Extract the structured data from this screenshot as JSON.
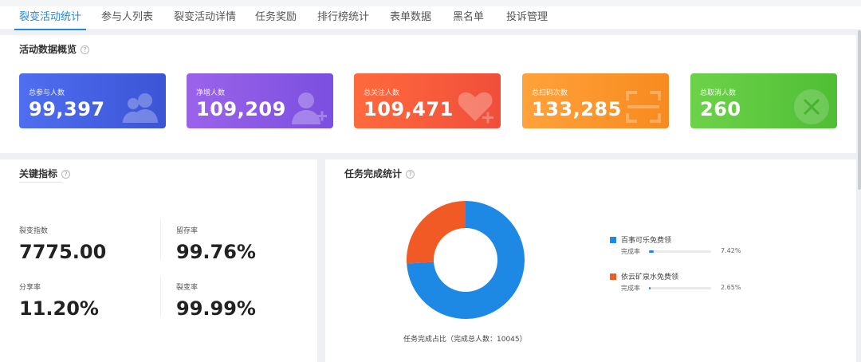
{
  "tabs": [
    {
      "label": "裂变活动统计",
      "active": true
    },
    {
      "label": "参与人列表",
      "active": false
    },
    {
      "label": "裂变活动详情",
      "active": false
    },
    {
      "label": "任务奖励",
      "active": false
    },
    {
      "label": "排行榜统计",
      "active": false
    },
    {
      "label": "表单数据",
      "active": false
    },
    {
      "label": "黑名单",
      "active": false
    },
    {
      "label": "投诉管理",
      "active": false
    }
  ],
  "overview": {
    "title": "活动数据概览",
    "cards": [
      {
        "label": "总参与人数",
        "value": "99,397",
        "color_from": "#4f6ef0",
        "color_to": "#3c54d6",
        "icon": "users-icon"
      },
      {
        "label": "净增人数",
        "value": "109,209",
        "color_from": "#9b63ea",
        "color_to": "#7b4fe0",
        "icon": "user-add-icon"
      },
      {
        "label": "总关注人数",
        "value": "109,471",
        "color_from": "#ff6a3d",
        "color_to": "#f04e3a",
        "icon": "heart-plus-icon"
      },
      {
        "label": "总扫码次数",
        "value": "133,285",
        "color_from": "#ffa23a",
        "color_to": "#f78a1f",
        "icon": "scan-icon"
      },
      {
        "label": "总取消人数",
        "value": "260",
        "color_from": "#6dd24a",
        "color_to": "#4fbe35",
        "icon": "close-circle-icon"
      }
    ]
  },
  "key_metrics": {
    "title": "关键指标",
    "items": [
      {
        "label": "裂变指数",
        "value": "7775.00"
      },
      {
        "label": "留存率",
        "value": "99.76%"
      },
      {
        "label": "分享率",
        "value": "11.20%"
      },
      {
        "label": "裂变率",
        "value": "99.99%"
      }
    ]
  },
  "task_stats": {
    "title": "任务完成统计",
    "caption": "任务完成占比（完成总人数：10045）",
    "rate_label": "完成率",
    "chart_data": {
      "type": "pie",
      "slices": [
        {
          "name": "百事可乐免费领",
          "value": 7.42,
          "color": "#1e88e5",
          "share": 0.74
        },
        {
          "name": "依云矿泉水免费领",
          "value": 2.65,
          "color": "#f15a24",
          "share": 0.26
        }
      ]
    },
    "legend": [
      {
        "name": "百事可乐免费领",
        "rate": "7.42%",
        "rate_value": 7.42,
        "color": "#1e88e5"
      },
      {
        "name": "依云矿泉水免费领",
        "rate": "2.65%",
        "rate_value": 2.65,
        "color": "#f15a24"
      }
    ]
  }
}
